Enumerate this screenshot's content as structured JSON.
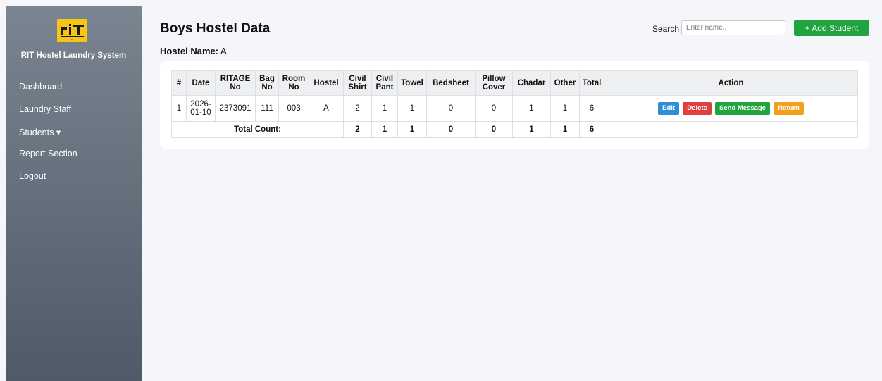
{
  "sidebar": {
    "brand": "RIT Hostel Laundry System",
    "logo_text": "rit",
    "items": [
      {
        "label": "Dashboard"
      },
      {
        "label": "Laundry Staff"
      },
      {
        "label": "Students ▾"
      },
      {
        "label": "Report Section"
      },
      {
        "label": "Logout"
      }
    ]
  },
  "header": {
    "title": "Boys Hostel Data",
    "hostel_label": "Hostel Name:",
    "hostel_value": "A",
    "search_label": "Search :",
    "search_placeholder": "Enter name..",
    "add_button": "+ Add Student"
  },
  "table": {
    "columns": [
      "#",
      "Date",
      "RITAGE No",
      "Bag No",
      "Room No",
      "Hostel",
      "Civil Shirt",
      "Civil Pant",
      "Towel",
      "Bedsheet",
      "Pillow Cover",
      "Chadar",
      "Other",
      "Total",
      "Action"
    ],
    "rows": [
      {
        "cells": [
          "1",
          "2026-01-10",
          "2373091",
          "111",
          "003",
          "A",
          "2",
          "1",
          "1",
          "0",
          "0",
          "1",
          "1",
          "6"
        ],
        "actions": [
          "Edit",
          "Delete",
          "Send Message",
          "Return"
        ]
      }
    ],
    "totals": {
      "label": "Total Count:",
      "values": [
        "2",
        "1",
        "1",
        "0",
        "0",
        "1",
        "1",
        "6"
      ]
    }
  },
  "colors": {
    "sidebar_top": "#7b8591",
    "sidebar_bottom": "#4e5a68",
    "logo": "#f5c518",
    "primary_green": "#21a33f",
    "edit_blue": "#2e8fd8",
    "delete_red": "#de3f3f",
    "return_orange": "#f0a01e"
  }
}
